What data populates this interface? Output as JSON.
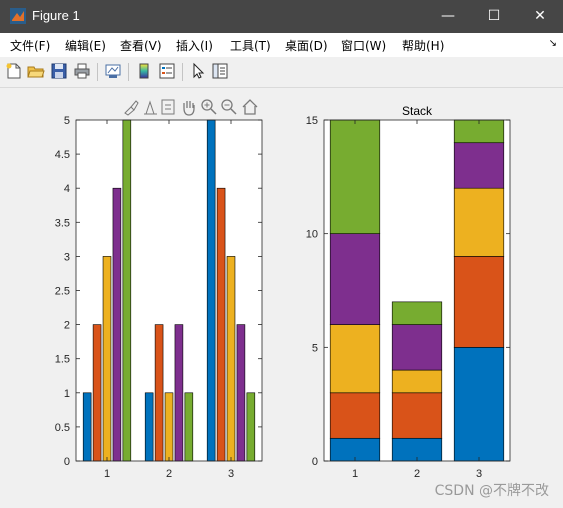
{
  "window": {
    "title": "Figure 1",
    "controls": {
      "minimize": "—",
      "maximize": "☐",
      "close": "✕"
    }
  },
  "menu": [
    {
      "label": "文件(F)"
    },
    {
      "label": "编辑(E)"
    },
    {
      "label": "查看(V)"
    },
    {
      "label": "插入(I)"
    },
    {
      "label": "工具(T)"
    },
    {
      "label": "桌面(D)"
    },
    {
      "label": "窗口(W)"
    },
    {
      "label": "帮助(H)"
    }
  ],
  "toolbar_icons": [
    "new-figure-icon",
    "open-file-icon",
    "save-icon",
    "print-icon",
    "link-plot-icon",
    "insert-colorbar-icon",
    "insert-legend-icon",
    "edit-plot-icon",
    "property-inspector-icon"
  ],
  "axes_toolbar_icons": [
    "brush-icon",
    "data-tips-icon",
    "rotate-icon",
    "pan-icon",
    "zoom-in-icon",
    "zoom-out-icon",
    "home-icon"
  ],
  "watermark": "CSDN @不牌不改",
  "colors": {
    "series": [
      "#0072BD",
      "#D95319",
      "#EDB120",
      "#7E2F8E",
      "#77AC30"
    ],
    "titlebar": "#464646",
    "figure_bg": "#f0f0f0"
  },
  "chart_data": [
    {
      "type": "bar",
      "title": "",
      "categories": [
        "1",
        "2",
        "3"
      ],
      "ylim": [
        0,
        5
      ],
      "yticks": [
        "0",
        "0.5",
        "1",
        "1.5",
        "2",
        "2.5",
        "3",
        "3.5",
        "4",
        "4.5",
        "5"
      ],
      "series": [
        {
          "values": [
            1,
            1,
            5
          ]
        },
        {
          "values": [
            2,
            2,
            4
          ]
        },
        {
          "values": [
            3,
            1,
            3
          ]
        },
        {
          "values": [
            4,
            2,
            2
          ]
        },
        {
          "values": [
            5,
            1,
            1
          ]
        }
      ]
    },
    {
      "type": "bar",
      "stacked": true,
      "title": "Stack",
      "categories": [
        "1",
        "2",
        "3"
      ],
      "ylim": [
        0,
        15
      ],
      "yticks": [
        "0",
        "5",
        "10",
        "15"
      ],
      "series": [
        {
          "values": [
            1,
            1,
            5
          ]
        },
        {
          "values": [
            2,
            2,
            4
          ]
        },
        {
          "values": [
            3,
            1,
            3
          ]
        },
        {
          "values": [
            4,
            2,
            2
          ]
        },
        {
          "values": [
            5,
            1,
            1
          ]
        }
      ]
    }
  ]
}
